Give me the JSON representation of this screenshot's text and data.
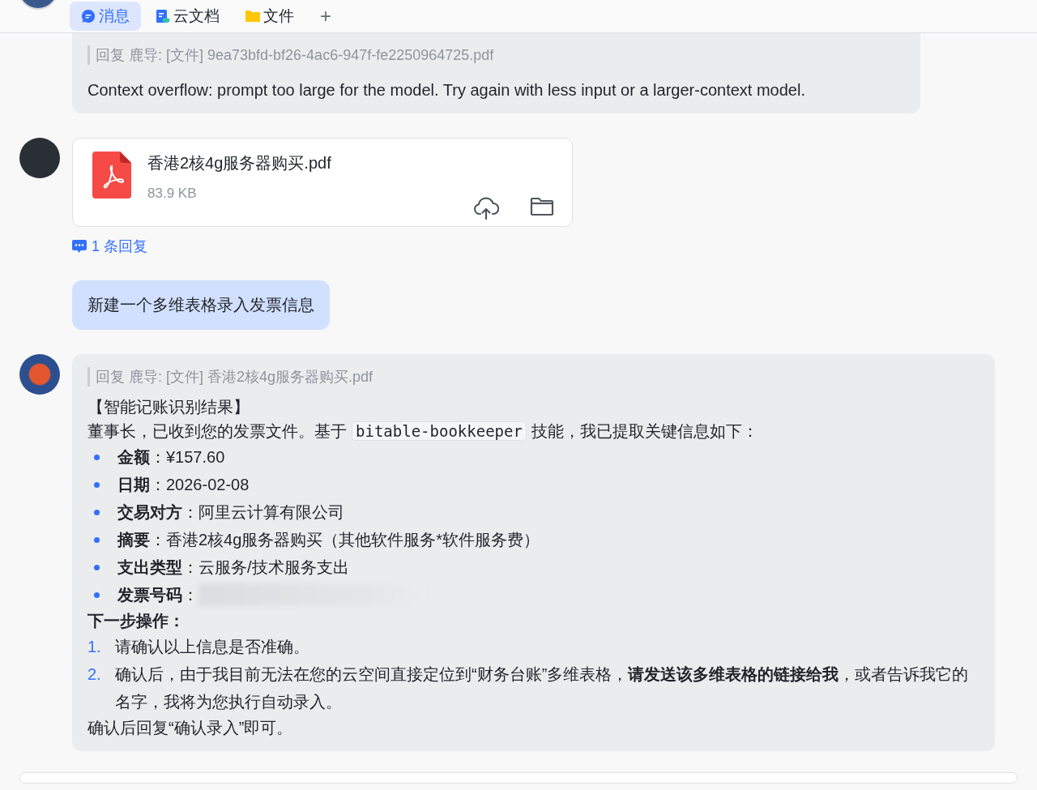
{
  "tabs": [
    {
      "label": "消息",
      "selected": true
    },
    {
      "label": "云文档",
      "selected": false
    },
    {
      "label": "文件",
      "selected": false
    }
  ],
  "add_tab": "+",
  "messages": [
    {
      "kind": "text",
      "quote": "回复 鹿导: [文件] 9ea73bfd-bf26-4ac6-947f-fe2250964725.pdf",
      "body": "Context overflow: prompt too large for the model. Try again with less input or a larger-context model."
    },
    {
      "kind": "file",
      "file_name": "香港2核4g服务器购买.pdf",
      "file_size": "83.9 KB",
      "thread": "1 条回复"
    },
    {
      "kind": "user",
      "body": "新建一个多维表格录入发票信息"
    },
    {
      "kind": "result",
      "quote": "回复 鹿导: [文件] 香港2核4g服务器购买.pdf",
      "title": "【智能记账识别结果】",
      "intro_before": "董事长，已收到您的发票文件。基于",
      "code": "bitable-bookkeeper",
      "intro_after": "技能，我已提取关键信息如下：",
      "fields": [
        {
          "text": "**金额**：¥157.60",
          "redacted": false
        },
        {
          "text": "**日期**：2026-02-08",
          "redacted": false
        },
        {
          "text": "**交易对方**：阿里云计算有限公司",
          "redacted": false
        },
        {
          "text": "**摘要**：香港2核4g服务器购买（其他软件服务*软件服务费）",
          "redacted": false
        },
        {
          "text": "**支出类型**：云服务/技术服务支出",
          "redacted": false
        },
        {
          "text": "**发票号码**：",
          "redacted": true
        }
      ],
      "steps_title": "下一步操作：",
      "steps": [
        {
          "number": "1.",
          "text": "请确认以上信息是否准确。"
        },
        {
          "number": "2.",
          "text": "确认后，由于我目前无法在您的云空间直接定位到“财务台账”多维表格，**请发送该多维表格的链接给我**，或者告诉我它的名字，我将为您执行自动录入。"
        }
      ],
      "closing": "确认后回复“确认录入”即可。"
    }
  ]
}
